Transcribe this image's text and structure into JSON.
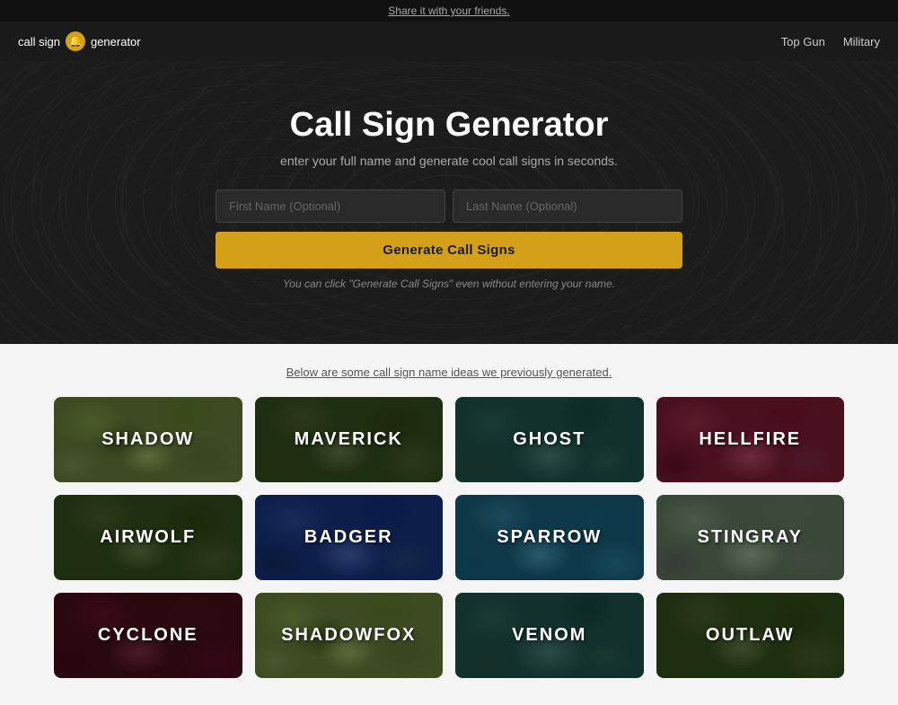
{
  "banner": {
    "text": "Share it with your friends."
  },
  "nav": {
    "logo_text_1": "call sign",
    "logo_text_2": "generator",
    "logo_icon": "🔔",
    "links": [
      {
        "label": "Top Gun",
        "href": "#"
      },
      {
        "label": "Military",
        "href": "#"
      }
    ]
  },
  "hero": {
    "title": "Call Sign Generator",
    "subtitle": "enter your full name and generate cool call signs in seconds.",
    "first_name_placeholder": "First Name (Optional)",
    "last_name_placeholder": "Last Name (Optional)",
    "generate_btn": "Generate Call Signs",
    "hint": "You can click \"Generate Call Signs\" even without entering your name."
  },
  "section": {
    "header": "Below are some call sign name ideas we previously generated.",
    "cards": [
      {
        "label": "SHADOW",
        "camo": "camo-olive"
      },
      {
        "label": "MAVERICK",
        "camo": "camo-green-dark"
      },
      {
        "label": "GHOST",
        "camo": "camo-teal"
      },
      {
        "label": "HELLFIRE",
        "camo": "camo-burgundy"
      },
      {
        "label": "AIRWOLF",
        "camo": "camo-green-dark"
      },
      {
        "label": "BADGER",
        "camo": "camo-blue-dark"
      },
      {
        "label": "SPARROW",
        "camo": "camo-blue-teal"
      },
      {
        "label": "STINGRAY",
        "camo": "camo-gray-green"
      },
      {
        "label": "CYCLONE",
        "camo": "camo-dark-maroon"
      },
      {
        "label": "SHADOWFOX",
        "camo": "camo-olive"
      },
      {
        "label": "VENOM",
        "camo": "camo-teal"
      },
      {
        "label": "OUTLAW",
        "camo": "camo-green-dark"
      }
    ]
  }
}
